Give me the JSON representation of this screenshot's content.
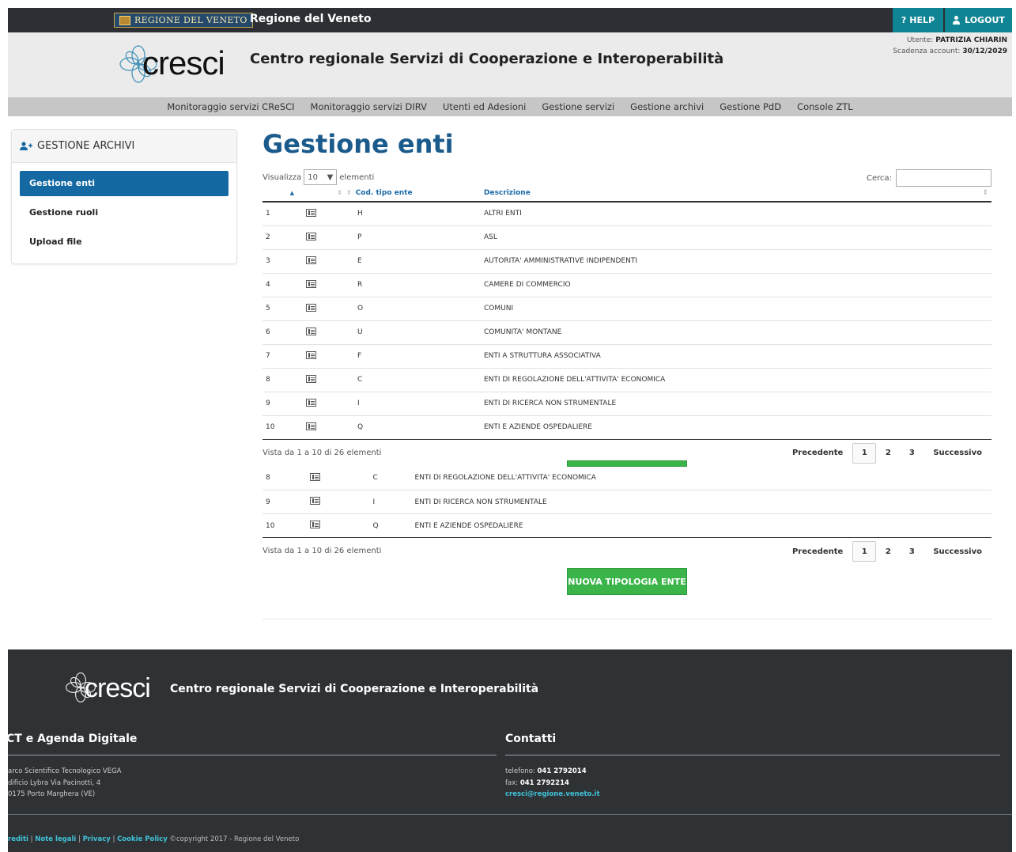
{
  "topbar": {
    "brand_logo": "REGIONE DEL VENETO",
    "brand_title": "Regione del Veneto",
    "help_label": "HELP",
    "logout_label": "LOGOUT"
  },
  "header": {
    "logo_text": "cresci",
    "title": "Centro regionale Servizi di Cooperazione e Interoperabilità",
    "user_label": "Utente:",
    "user_name": "PATRIZIA CHIARIN",
    "expiry_label": "Scadenza account:",
    "expiry_date": "30/12/2029"
  },
  "nav": {
    "items": [
      {
        "label": "Monitoraggio servizi CReSCI"
      },
      {
        "label": "Monitoraggio servizi DIRV"
      },
      {
        "label": "Utenti ed Adesioni"
      },
      {
        "label": "Gestione servizi"
      },
      {
        "label": "Gestione archivi"
      },
      {
        "label": "Gestione PdD"
      },
      {
        "label": "Console ZTL"
      }
    ]
  },
  "sidebar": {
    "title": "GESTIONE ARCHIVI",
    "items": [
      {
        "label": "Gestione enti",
        "active": true
      },
      {
        "label": "Gestione ruoli",
        "active": false
      },
      {
        "label": "Upload file",
        "active": false
      }
    ]
  },
  "main": {
    "title": "Gestione enti",
    "show_label": "Visualizza",
    "page_size": "10",
    "elements_label": "elementi",
    "search_label": "Cerca:",
    "search_value": "",
    "columns": [
      "",
      "",
      "Cod. tipo ente",
      "Descrizione"
    ],
    "rows": [
      {
        "n": "1",
        "code": "H",
        "desc": "ALTRI ENTI"
      },
      {
        "n": "2",
        "code": "P",
        "desc": "ASL"
      },
      {
        "n": "3",
        "code": "E",
        "desc": "AUTORITA' AMMINISTRATIVE INDIPENDENTI"
      },
      {
        "n": "4",
        "code": "R",
        "desc": "CAMERE DI COMMERCIO"
      },
      {
        "n": "5",
        "code": "O",
        "desc": "COMUNI"
      },
      {
        "n": "6",
        "code": "U",
        "desc": "COMUNITA' MONTANE"
      },
      {
        "n": "7",
        "code": "F",
        "desc": "ENTI A STRUTTURA ASSOCIATIVA"
      },
      {
        "n": "8",
        "code": "C",
        "desc": "ENTI DI REGOLAZIONE DELL'ATTIVITA' ECONOMICA"
      },
      {
        "n": "9",
        "code": "I",
        "desc": "ENTI DI RICERCA NON STRUMENTALE"
      },
      {
        "n": "10",
        "code": "Q",
        "desc": "ENTI E AZIENDE OSPEDALIERE"
      }
    ],
    "ghost_rows": [
      {
        "n": "8",
        "code": "C",
        "desc": "ENTI DI REGOLAZIONE DELL'ATTIVITA' ECONOMICA"
      },
      {
        "n": "9",
        "code": "I",
        "desc": "ENTI DI RICERCA NON STRUMENTALE"
      },
      {
        "n": "10",
        "code": "Q",
        "desc": "ENTI E AZIENDE OSPEDALIERE"
      }
    ],
    "info": "Vista da 1 a 10 di 26 elementi",
    "pager": {
      "prev": "Precedente",
      "pages": [
        "1",
        "2",
        "3"
      ],
      "next": "Successivo",
      "current": "1"
    },
    "new_button": "NUOVA TIPOLOGIA ENTE"
  },
  "footer": {
    "logo_text": "cresci",
    "title": "Centro regionale Servizi di Cooperazione e Interoperabilità",
    "left_head": "CT e Agenda Digitale",
    "left_lines": [
      "arco Scientifico Tecnologico VEGA",
      "dificio Lybra Via Pacinotti, 4",
      "0175 Porto Marghera (VE)"
    ],
    "right_head": "Contatti",
    "phone_label": "telefono:",
    "phone": "041 2792014",
    "fax_label": "fax:",
    "fax": "041 2792214",
    "email": "cresci@regione.veneto.it",
    "links": [
      "rediti",
      "Note legali",
      "Privacy",
      "Cookie Policy"
    ],
    "copyright": "©copyright 2017 - Regione del Veneto"
  },
  "colors": {
    "topbar": "#2c2f33",
    "accent": "#0f8494",
    "primary": "#1469a3",
    "title": "#1a5b8c",
    "green": "#3bb54a",
    "footer": "#2f3235"
  }
}
